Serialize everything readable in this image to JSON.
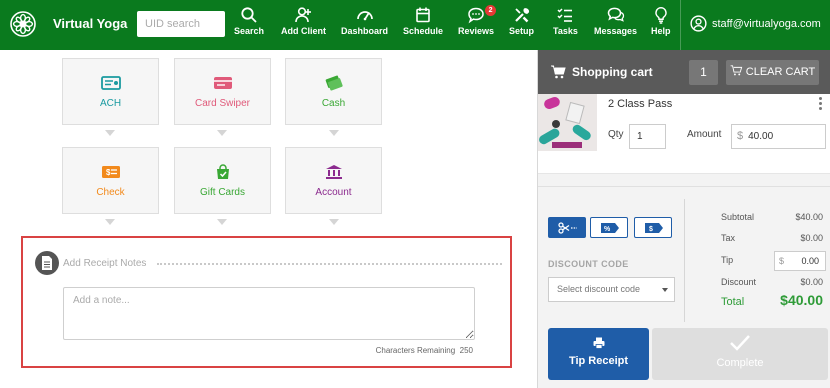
{
  "nav": {
    "brand": "Virtual Yoga",
    "search_placeholder": "UID search",
    "items": [
      {
        "label": "Search",
        "icon": "search-icon"
      },
      {
        "label": "Add Client",
        "icon": "add-user-icon"
      },
      {
        "label": "Dashboard",
        "icon": "dashboard-icon"
      },
      {
        "label": "Schedule",
        "icon": "calendar-icon"
      },
      {
        "label": "Reviews",
        "icon": "chat-icon",
        "badge": "2"
      },
      {
        "label": "Setup",
        "icon": "tools-icon"
      },
      {
        "label": "Tasks",
        "icon": "tasks-icon"
      },
      {
        "label": "Messages",
        "icon": "messages-icon"
      },
      {
        "label": "Help",
        "icon": "lightbulb-icon"
      }
    ],
    "user": "staff@virtualyoga.com",
    "color": "#0a7a1e"
  },
  "payment_methods": [
    {
      "label": "ACH",
      "color": "#1a9aa0",
      "icon": "ach-icon"
    },
    {
      "label": "Card Swiper",
      "color": "#e05a7a",
      "icon": "card-swiper-icon"
    },
    {
      "label": "Cash",
      "color": "#3aa835",
      "icon": "cash-icon"
    },
    {
      "label": "Check",
      "color": "#f28a1c",
      "icon": "check-icon"
    },
    {
      "label": "Gift Cards",
      "color": "#3aa835",
      "icon": "gift-card-icon"
    },
    {
      "label": "Account",
      "color": "#8b2a8e",
      "icon": "account-icon"
    }
  ],
  "receipt": {
    "title": "Add Receipt Notes",
    "placeholder": "Add a note...",
    "chars_label": "Characters Remaining",
    "chars_value": "250"
  },
  "cart": {
    "title": "Shopping cart",
    "count": "1",
    "clear_label": "CLEAR CART",
    "item": {
      "name": "2 Class Pass",
      "qty_label": "Qty",
      "qty": "1",
      "amount_label": "Amount",
      "currency": "$",
      "amount": "40.00"
    },
    "discount_code_label": "DISCOUNT CODE",
    "discount_placeholder": "Select discount code",
    "summary": {
      "subtotal_label": "Subtotal",
      "subtotal": "$40.00",
      "tax_label": "Tax",
      "tax": "$0.00",
      "tip_label": "Tip",
      "tip_currency": "$",
      "tip": "0.00",
      "discount_label": "Discount",
      "discount": "$0.00",
      "total_label": "Total",
      "total": "$40.00"
    },
    "tip_receipt_label": "Tip Receipt",
    "complete_label": "Complete",
    "accent": "#1f5da8",
    "total_color": "#2e9b37"
  }
}
